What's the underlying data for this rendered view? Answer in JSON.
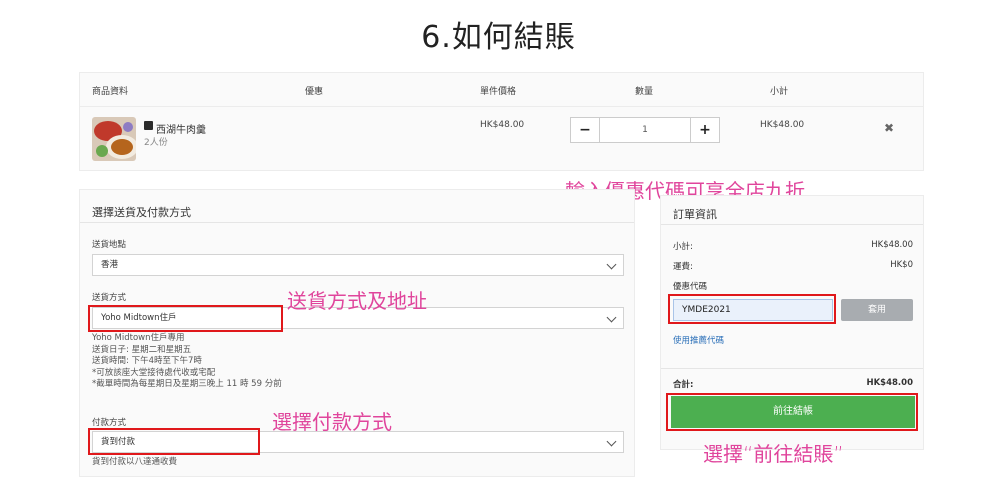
{
  "page": {
    "title": "6.如何結賬"
  },
  "cart": {
    "columns": [
      "商品資料",
      "優惠",
      "單件價格",
      "數量",
      "小計"
    ],
    "item": {
      "name": "西湖牛肉羹",
      "serving": "2人份",
      "unit_price": "HK$48.00",
      "quantity": "1",
      "subtotal": "HK$48.00",
      "minus": "−",
      "plus": "+",
      "remove": "✖"
    }
  },
  "shipping": {
    "title": "選擇送貨及付款方式",
    "location_label": "送貨地點",
    "location_value": "香港",
    "method_label": "送貨方式",
    "method_value": "Yoho Midtown住戶",
    "notes": [
      "Yoho Midtown住戶專用",
      "送貨日子: 星期二和星期五",
      "送貨時間: 下午4時至下午7時",
      "*可放該座大堂接待處代收或宅配",
      "*截單時間為每星期日及星期三晚上 11 時 59 分前"
    ],
    "payment_label": "付款方式",
    "payment_value": "貨到付款",
    "payment_note": "貨到付款以八達通收費"
  },
  "order": {
    "title": "訂單資訊",
    "subtotal_label": "小計:",
    "subtotal_value": "HK$48.00",
    "shipping_label": "運費:",
    "shipping_value": "HK$0",
    "coupon_label": "優惠代碼",
    "coupon_value": "YMDE2021",
    "apply_label": "套用",
    "referral_link": "使用推薦代碼",
    "total_label": "合計:",
    "total_value": "HK$48.00",
    "checkout_label": "前往結帳"
  },
  "annotations": {
    "coupon": "輸入優惠代碼可享全店九折",
    "shipping": "送貨方式及地址",
    "payment": "選擇付款方式",
    "checkout": "選擇“前往結賬”"
  },
  "colors": {
    "annotation": "#e0459c",
    "highlight_box": "#e0181b",
    "checkout_button": "#4caf50",
    "link": "#2a6fb8"
  }
}
